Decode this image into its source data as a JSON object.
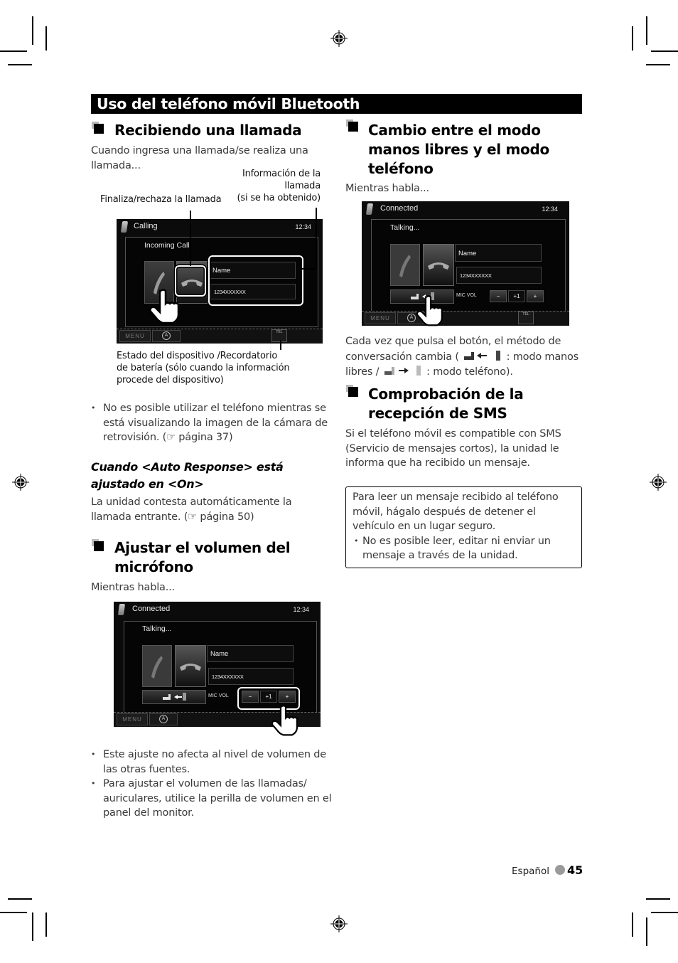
{
  "page": {
    "title": "Uso del teléfono móvil Bluetooth",
    "footer": {
      "language": "Español",
      "page_number": "45"
    }
  },
  "left": {
    "receiving": {
      "heading": "Recibiendo una llamada",
      "intro": "Cuando ingresa una llamada/se realiza una llamada...",
      "callouts": {
        "end_reject": "Finaliza/rechaza la llamada",
        "call_info": [
          "Información de la",
          "llamada",
          "(si se ha obtenido)"
        ],
        "device_status": [
          "Estado del dispositivo /Recordatorio",
          "de batería (sólo cuando la información",
          "procede del dispositivo)"
        ]
      },
      "screen": {
        "status": "Calling",
        "clock": "12:34",
        "panel_title": "Incoming Call",
        "name_field": "Name",
        "number_field": "1234XXXXXX",
        "menu_label": "MENU",
        "tel_label": "TEL"
      },
      "bullet": "No es posible utilizar el teléfono mientras se está visualizando la imagen de la cámara de retrovisión. (☞ página 37)"
    },
    "auto_response": {
      "heading": "Cuando <Auto Response> está ajustado en <On>",
      "text": "La unidad contesta automáticamente la llamada entrante. (☞ página 50)"
    },
    "mic_volume": {
      "heading": "Ajustar el volumen del micrófono",
      "intro": "Mientras habla...",
      "screen": {
        "status": "Connected",
        "clock": "12:34",
        "panel_title": "Talking...",
        "name_field": "Name",
        "number_field": "1234XXXXXX",
        "mic_vol_label": "MIC VOL",
        "minus": "−",
        "value": "+1",
        "plus": "+",
        "menu_label": "MENU"
      },
      "bullets": [
        "Este ajuste no afecta al nivel de volumen de las otras fuentes.",
        "Para ajustar el volumen de las llamadas/ auriculares, utilice la perilla de volumen en el panel del monitor."
      ]
    }
  },
  "right": {
    "switch_mode": {
      "heading": "Cambio entre el modo manos libres y el modo teléfono",
      "intro": "Mientras habla...",
      "screen": {
        "status": "Connected",
        "clock": "12:34",
        "panel_title": "Talking...",
        "name_field": "Name",
        "number_field": "1234XXXXXX",
        "mic_vol_label": "MIC VOL",
        "minus": "−",
        "value": "+1",
        "plus": "+",
        "menu_label": "MENU",
        "tel_label": "TEL"
      },
      "text_parts": {
        "a": "Cada vez que pulsa el botón, el método de conversación cambia (",
        "b": ": modo manos libres /",
        "c": ": modo teléfono)."
      }
    },
    "sms": {
      "heading": "Comprobación de la recepción de SMS",
      "text": "Si el teléfono móvil es compatible con SMS (Servicio de mensajes cortos), la unidad le informa que ha recibido un mensaje.",
      "note": {
        "text": "Para leer un mensaje recibido al teléfono móvil, hágalo después de detener el vehículo en un lugar seguro.",
        "bullet": "No es posible leer, editar ni enviar un mensaje a través de la unidad."
      }
    }
  }
}
